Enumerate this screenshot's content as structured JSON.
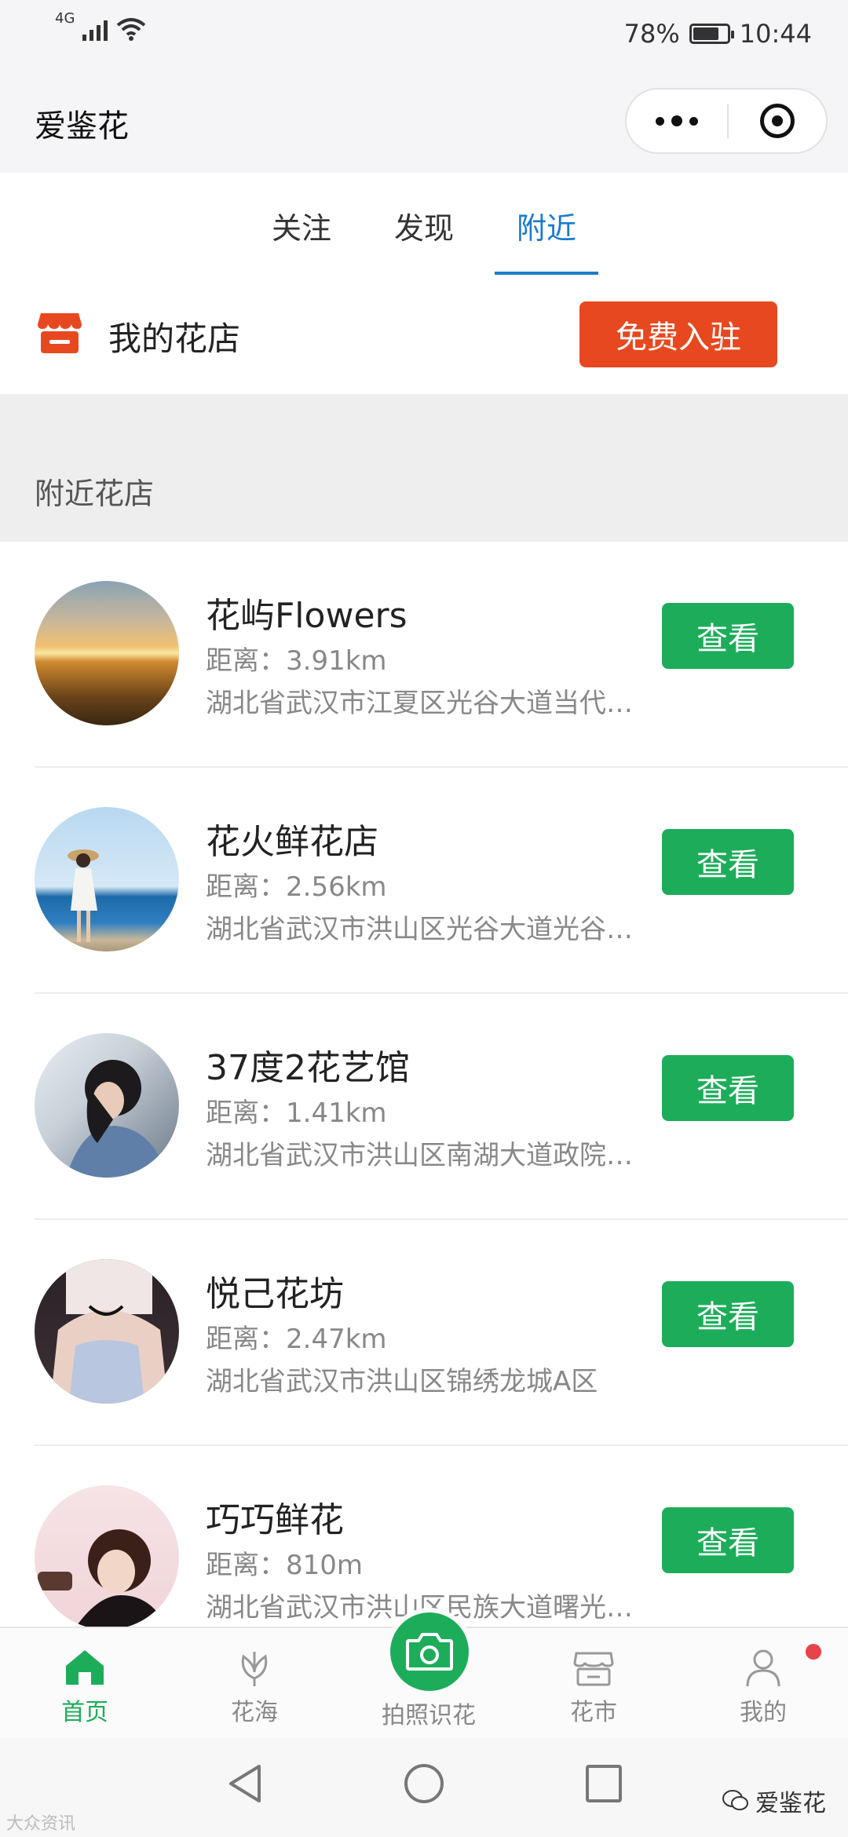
{
  "status_bar": {
    "network": "4G",
    "battery_percent": "78%",
    "battery_level": 0.78,
    "time": "10:44"
  },
  "app": {
    "title": "爱鉴花"
  },
  "tabs": [
    {
      "label": "关注",
      "active": false
    },
    {
      "label": "发现",
      "active": false
    },
    {
      "label": "附近",
      "active": true
    }
  ],
  "my_shop": {
    "label": "我的花店",
    "button": "免费入驻",
    "icon": "shop-icon"
  },
  "section": {
    "title": "附近花店"
  },
  "shops": [
    {
      "name": "花屿Flowers",
      "distance": "距离：3.91km",
      "address": "湖北省武汉市江夏区光谷大道当代…",
      "button": "查看",
      "avatar": "sunset-photo"
    },
    {
      "name": "花火鲜花店",
      "distance": "距离：2.56km",
      "address": "湖北省武汉市洪山区光谷大道光谷…",
      "button": "查看",
      "avatar": "beach-photo"
    },
    {
      "name": "37度2花艺馆",
      "distance": "距离：1.41km",
      "address": "湖北省武汉市洪山区南湖大道政院…",
      "button": "查看",
      "avatar": "portrait-photo"
    },
    {
      "name": "悦己花坊",
      "distance": "距离：2.47km",
      "address": "湖北省武汉市洪山区锦绣龙城A区",
      "button": "查看",
      "avatar": "portrait-photo"
    },
    {
      "name": "巧巧鲜花",
      "distance": "距离：810m",
      "address": "湖北省武汉市洪山区民族大道曙光…",
      "button": "查看",
      "avatar": "portrait-photo"
    }
  ],
  "tabbar": [
    {
      "label": "首页",
      "icon": "home-icon",
      "active": true
    },
    {
      "label": "花海",
      "icon": "flower-icon",
      "active": false
    },
    {
      "label": "拍照识花",
      "icon": "camera-icon",
      "active": false
    },
    {
      "label": "花市",
      "icon": "store-icon",
      "active": false
    },
    {
      "label": "我的",
      "icon": "user-icon",
      "active": false
    }
  ],
  "watermark": {
    "left": "大众资讯",
    "right": "爱鉴花"
  },
  "colors": {
    "accent_blue": "#1a7ad0",
    "green": "#1dad5a",
    "orange": "#e8481f",
    "badge_red": "#e8424a"
  }
}
